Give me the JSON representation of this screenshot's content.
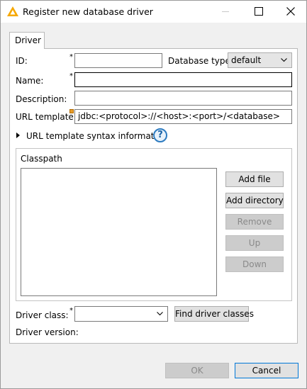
{
  "window": {
    "title": "Register new database driver"
  },
  "tabs": [
    {
      "label": "Driver"
    }
  ],
  "form": {
    "id_label": "ID:",
    "id_value": "",
    "required_marker": "*",
    "db_type_label": "Database type:",
    "db_type_value": "default",
    "name_label": "Name:",
    "name_value": "",
    "description_label": "Description:",
    "description_value": "",
    "url_template_label": "URL template:",
    "url_template_value": "jdbc:<protocol>://<host>:<port>/<database>",
    "url_syntax_info": "URL template syntax information",
    "help_icon_glyph": "?"
  },
  "classpath": {
    "label": "Classpath",
    "buttons": {
      "add_file": "Add file",
      "add_directory": "Add directory",
      "remove": "Remove",
      "up": "Up",
      "down": "Down"
    }
  },
  "driver": {
    "class_label": "Driver class:",
    "class_value": "",
    "find_button": "Find driver classes",
    "version_label": "Driver version:",
    "version_value": ""
  },
  "footer": {
    "ok": "OK",
    "cancel": "Cancel"
  },
  "colors": {
    "accent": "#0078d7",
    "warning": "#e89d2b",
    "help": "#2d7bc0"
  }
}
